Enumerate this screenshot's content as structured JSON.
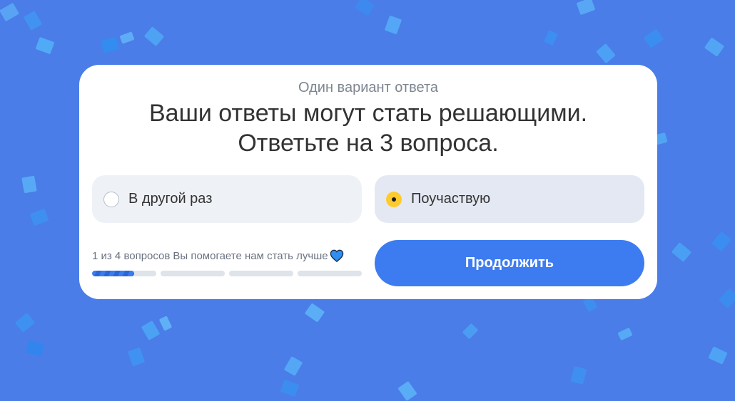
{
  "background_color": "#4a7de8",
  "accent_color": "#3d7cf0",
  "survey": {
    "subtitle": "Один вариант ответа",
    "title_line1": "Ваши ответы могут стать решающими.",
    "title_line2": "Ответьте на 3 вопроса.",
    "options": [
      {
        "label": "В другой раз",
        "selected": false
      },
      {
        "label": "Поучаствую",
        "selected": true
      }
    ],
    "progress": {
      "counter_text": "1 из 4 вопросов",
      "message": "Вы помогаете нам стать лучше",
      "heart_icon": "blue-heart-icon",
      "current": 1,
      "total": 4,
      "first_segment_fill": 0.65
    },
    "continue_label": "Продолжить"
  }
}
